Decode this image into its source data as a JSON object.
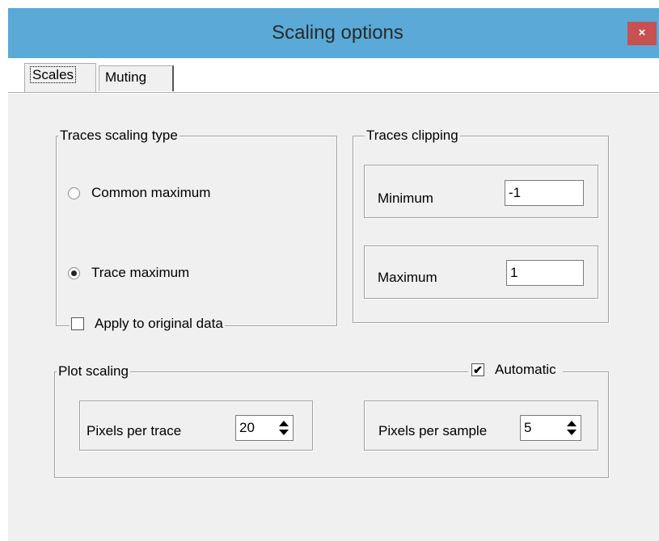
{
  "window": {
    "title": "Scaling options",
    "close_label": "×"
  },
  "tabs": [
    {
      "label": "Scales"
    },
    {
      "label": "Muting"
    }
  ],
  "traces_scaling": {
    "legend": "Traces scaling type",
    "options": [
      {
        "label": "Common maximum",
        "checked": false
      },
      {
        "label": "Trace maximum",
        "checked": true
      }
    ],
    "apply_label": "Apply to original data",
    "apply_checked": false
  },
  "traces_clipping": {
    "legend": "Traces clipping",
    "minimum_label": "Minimum",
    "minimum_value": "-1",
    "maximum_label": "Maximum",
    "maximum_value": "1"
  },
  "plot_scaling": {
    "legend": "Plot scaling",
    "automatic_label": "Automatic",
    "automatic_checked": true,
    "pixels_per_trace_label": "Pixels per trace",
    "pixels_per_trace_value": "20",
    "pixels_per_sample_label": "Pixels per sample",
    "pixels_per_sample_value": "5"
  },
  "colors": {
    "titlebar": "#5aa9d6",
    "close": "#c75050",
    "dialog": "#f0f0f0"
  }
}
